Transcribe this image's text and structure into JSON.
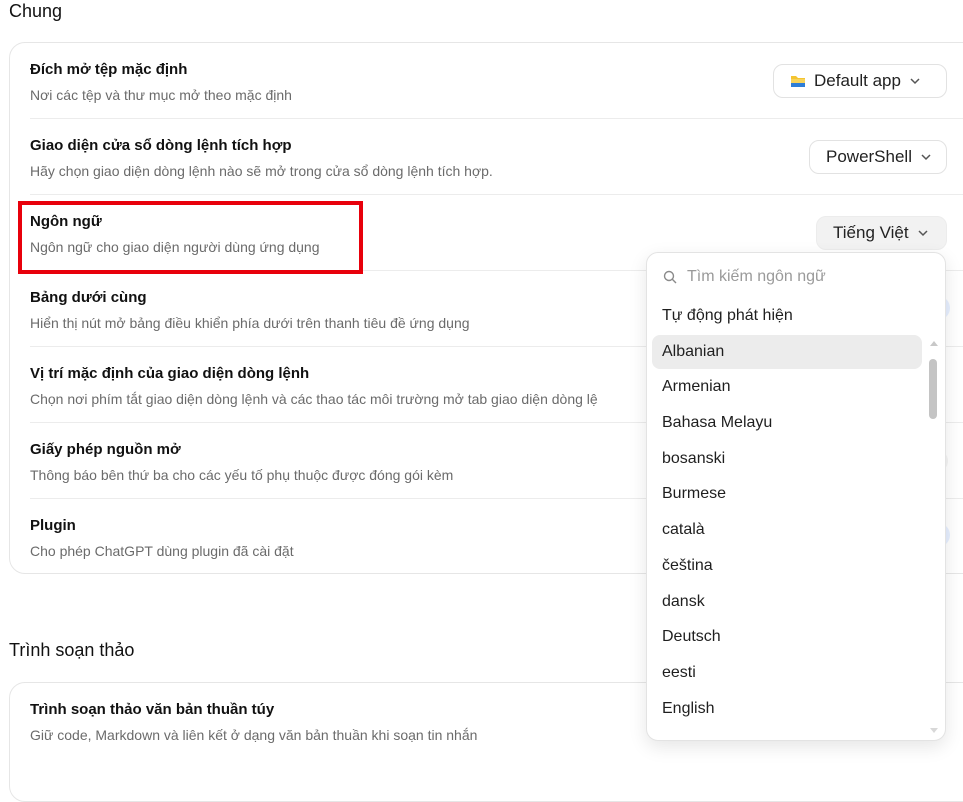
{
  "sections": {
    "general": "Chung",
    "editor": "Trình soạn thảo"
  },
  "rows": [
    {
      "title": "Đích mở tệp mặc định",
      "desc": "Nơi các tệp và thư mục mở theo mặc định"
    },
    {
      "title": "Giao diện cửa sổ dòng lệnh tích hợp",
      "desc": "Hãy chọn giao diện dòng lệnh nào sẽ mở trong cửa sổ dòng lệnh tích hợp."
    },
    {
      "title": "Ngôn ngữ",
      "desc": "Ngôn ngữ cho giao diện người dùng ứng dụng"
    },
    {
      "title": "Bảng dưới cùng",
      "desc": "Hiển thị nút mở bảng điều khiển phía dưới trên thanh tiêu đề ứng dụng"
    },
    {
      "title": "Vị trí mặc định của giao diện dòng lệnh",
      "desc": "Chọn nơi phím tắt giao diện dòng lệnh và các thao tác môi trường mở tab giao diện dòng lệ"
    },
    {
      "title": "Giấy phép nguồn mở",
      "desc": "Thông báo bên thứ ba cho các yếu tố phụ thuộc được đóng gói kèm"
    },
    {
      "title": "Plugin",
      "desc": "Cho phép ChatGPT dùng plugin đã cài đặt"
    }
  ],
  "editor_rows": [
    {
      "title": "Trình soạn thảo văn bản thuần túy",
      "desc": "Giữ code, Markdown và liên kết ở dạng văn bản thuần khi soạn tin nhắn"
    }
  ],
  "controls": {
    "open_target": "Default app",
    "terminal": "PowerShell",
    "language": "Tiếng Việt"
  },
  "dropdown": {
    "search_placeholder": "Tìm kiếm ngôn ngữ",
    "items": [
      "Tự động phát hiện",
      "Albanian",
      "Armenian",
      "Bahasa Melayu",
      "bosanski",
      "Burmese",
      "català",
      "čeština",
      "dansk",
      "Deutsch",
      "eesti",
      "English"
    ],
    "selected": "Albanian"
  },
  "icons": {
    "folder": "folder-icon",
    "chevron": "chevron-down-icon",
    "search": "search-icon"
  },
  "colors": {
    "highlight": "#e8000b",
    "toggle": "#e6efff"
  }
}
